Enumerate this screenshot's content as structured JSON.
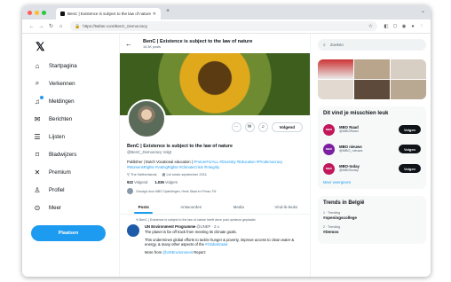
{
  "browser": {
    "tab_title": "BenC | Existence is subject to the law of nature",
    "url": "https://twitter.com/BenC_Democracy"
  },
  "nav": {
    "items": [
      {
        "label": "Startpagina",
        "icon": "home-icon"
      },
      {
        "label": "Verkennen",
        "icon": "search-icon"
      },
      {
        "label": "Meldingen",
        "icon": "bell-icon"
      },
      {
        "label": "Berichten",
        "icon": "mail-icon"
      },
      {
        "label": "Lijsten",
        "icon": "list-icon"
      },
      {
        "label": "Bladwijzers",
        "icon": "bookmark-icon"
      },
      {
        "label": "Premium",
        "icon": "x-icon"
      },
      {
        "label": "Profiel",
        "icon": "profile-icon"
      },
      {
        "label": "Meer",
        "icon": "more-icon"
      }
    ],
    "post_label": "Plaatsen"
  },
  "profile": {
    "header_name": "BenC | Existence is subject to the law of nature",
    "posts_count": "16,3K posts",
    "name": "BenC | Existence is subject to the law of nature",
    "handle": "@BenC_Democracy",
    "follows_you": "Volgt",
    "follow_label": "Volgend",
    "bio_start": "Publisher | Dutch Vocational education |",
    "bio_tags": "#FutureForALL #Diversity #Education #Prodemocracy #WomensRights #VotingRights #ClimateCrisis #Integrity",
    "location": "The Netherlands",
    "joined": "Lid sinds september 2011",
    "following_count": "922",
    "following_label": "Volgend",
    "followers_count": "1.036",
    "followers_label": "Volgers",
    "followed_by": "Gevolgd door MBO Opleidingen, Henk Staal en Prinsu TM"
  },
  "tabs": [
    "Posts",
    "Antwoorden",
    "Media",
    "Vind-ik-leuks"
  ],
  "feed": {
    "repost_line": "BenC | Existence is subject to the law of nature heeft deze post opnieuw geplaatst",
    "author": "UN Environment Programme",
    "author_meta": "@UNEP · 2 u",
    "line1": "The planet is far off track from meeting its climate goals.",
    "line2": "This undermines global efforts to tackle hunger & poverty, improve access to clean water & energy, & many other aspects of the",
    "line2_link": "#GlobalGoals",
    "line3": "More from",
    "line3_link": "@UNEnvironment",
    "line3_end": "Report:"
  },
  "right": {
    "search_placeholder": "Zoeken",
    "suggest_title": "Dit vind je misschien leuk",
    "suggestions": [
      {
        "name": "MBO Raad",
        "handle": "@MBORaad",
        "logo": "MBO",
        "color": "#c2185b"
      },
      {
        "name": "MBO nieuws",
        "handle": "@MBO_nieuws",
        "logo": "MBO",
        "color": "#7b1fa2"
      },
      {
        "name": "MBO-today",
        "handle": "@MBOtoday",
        "logo": "MBO",
        "color": "#c2185b"
      }
    ],
    "suggest_follow": "Volgen",
    "more": "Meer weergeven",
    "trends_title": "Trends in België",
    "trends": [
      {
        "meta": "1 · Trending",
        "tag": "#openingscollege"
      },
      {
        "meta": "2 · Trending",
        "tag": "#Demos"
      }
    ]
  }
}
